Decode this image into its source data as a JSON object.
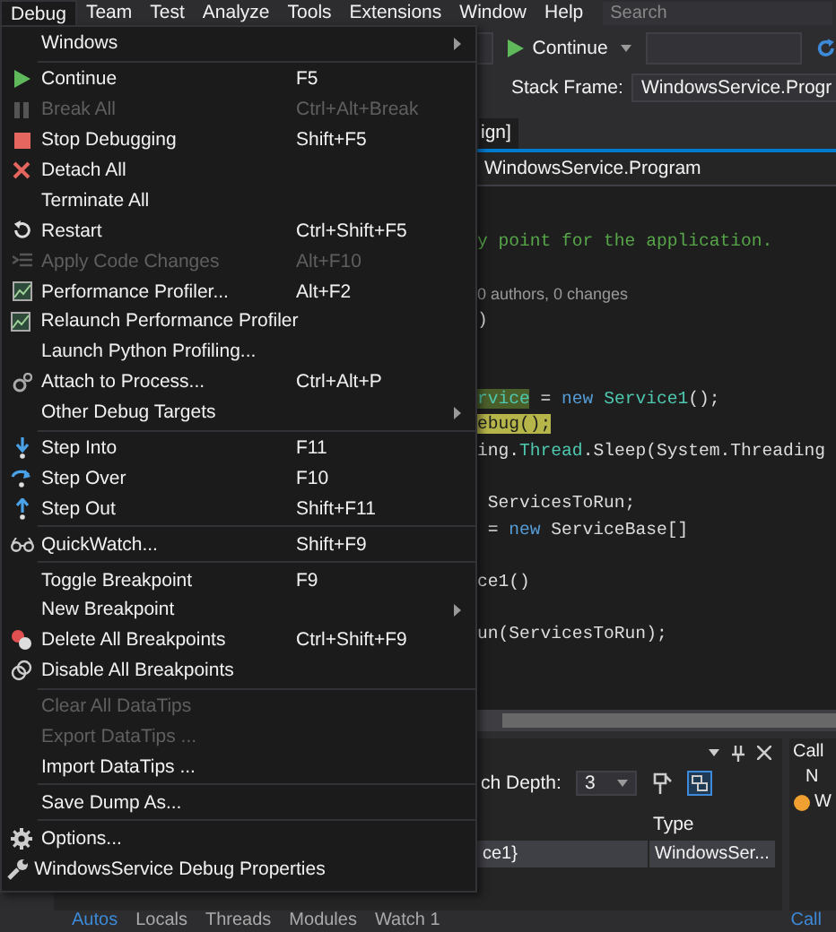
{
  "menubar": {
    "items": [
      {
        "label": "Debug",
        "selected": true
      },
      {
        "label": "Team",
        "selected": false
      },
      {
        "label": "Test",
        "selected": false
      },
      {
        "label": "Analyze",
        "selected": false
      },
      {
        "label": "Tools",
        "selected": false
      },
      {
        "label": "Extensions",
        "selected": false
      },
      {
        "label": "Window",
        "selected": false
      },
      {
        "label": "Help",
        "selected": false
      }
    ],
    "search": {
      "placeholder": "Search"
    }
  },
  "toolbar": {
    "continue_button": "Continue",
    "stack_frame_label": "Stack Frame:",
    "stack_frame_value": "WindowsService.Progr"
  },
  "document_tab": "ign]",
  "navigation_bar": "WindowsService.Program",
  "code_lines": [
    [
      {
        "text": "y point for the application.",
        "kind": "comment"
      }
    ],
    [
      {
        "text": "0 authors, 0 changes",
        "kind": "lens"
      }
    ],
    [
      {
        "text": ")",
        "kind": "plain"
      }
    ],
    [
      {
        "text": "rvice",
        "kind": "hl-green"
      },
      {
        "text": " = ",
        "kind": "plain"
      },
      {
        "text": "new",
        "kind": "keyword"
      },
      {
        "text": " Service1",
        "kind": "type"
      },
      {
        "text": "();",
        "kind": "plain"
      }
    ],
    [
      {
        "text": "ebug();",
        "kind": "hl-yellow"
      }
    ],
    [
      {
        "text": "ing.",
        "kind": "plain"
      },
      {
        "text": "Thread",
        "kind": "type"
      },
      {
        "text": ".Sleep(System.Threading",
        "kind": "plain"
      }
    ],
    [
      {
        "text": " ServicesToRun;",
        "kind": "plain"
      }
    ],
    [
      {
        "text": " = ",
        "kind": "plain"
      },
      {
        "text": "new",
        "kind": "keyword"
      },
      {
        "text": " ServiceBase[]",
        "kind": "plain"
      }
    ],
    [
      {
        "text": "ce1()",
        "kind": "plain"
      }
    ],
    [
      {
        "text": "un(ServicesToRun);",
        "kind": "plain"
      }
    ]
  ],
  "autos_panel": {
    "depth_label": "ch Depth:",
    "depth_value": "3",
    "columns": [
      "Type"
    ],
    "rows": [
      {
        "value": "ce1}",
        "type": "WindowsSer..."
      }
    ]
  },
  "call_stack_panel": {
    "title": "Call",
    "column": "N",
    "row": "W"
  },
  "bottom_tabs": [
    {
      "label": "Autos",
      "selected": true
    },
    {
      "label": "Locals",
      "selected": false
    },
    {
      "label": "Threads",
      "selected": false
    },
    {
      "label": "Modules",
      "selected": false
    },
    {
      "label": "Watch 1",
      "selected": false
    }
  ],
  "bottom_right_tab": "Call",
  "debug_menu": [
    {
      "kind": "item",
      "label": "Windows",
      "submenu": true,
      "disabled": false
    },
    {
      "kind": "separator"
    },
    {
      "kind": "item",
      "label": "Continue",
      "shortcut": "F5",
      "disabled": false
    },
    {
      "kind": "item",
      "label": "Break All",
      "shortcut": "Ctrl+Alt+Break",
      "disabled": true
    },
    {
      "kind": "item",
      "label": "Stop Debugging",
      "shortcut": "Shift+F5",
      "disabled": false
    },
    {
      "kind": "item",
      "label": "Detach All",
      "disabled": false
    },
    {
      "kind": "item",
      "label": "Terminate All",
      "disabled": false
    },
    {
      "kind": "item",
      "label": "Restart",
      "shortcut": "Ctrl+Shift+F5",
      "disabled": false
    },
    {
      "kind": "item",
      "label": "Apply Code Changes",
      "shortcut": "Alt+F10",
      "disabled": true
    },
    {
      "kind": "item",
      "label": "Performance Profiler...",
      "shortcut": "Alt+F2",
      "disabled": false
    },
    {
      "kind": "item",
      "label": "Relaunch Performance Profiler",
      "disabled": false
    },
    {
      "kind": "item",
      "label": "Launch Python Profiling...",
      "disabled": false
    },
    {
      "kind": "item",
      "label": "Attach to Process...",
      "shortcut": "Ctrl+Alt+P",
      "disabled": false
    },
    {
      "kind": "item",
      "label": "Other Debug Targets",
      "submenu": true,
      "disabled": false
    },
    {
      "kind": "separator"
    },
    {
      "kind": "item",
      "label": "Step Into",
      "shortcut": "F11",
      "disabled": false
    },
    {
      "kind": "item",
      "label": "Step Over",
      "shortcut": "F10",
      "disabled": false
    },
    {
      "kind": "item",
      "label": "Step Out",
      "shortcut": "Shift+F11",
      "disabled": false
    },
    {
      "kind": "separator"
    },
    {
      "kind": "item",
      "label": "QuickWatch...",
      "shortcut": "Shift+F9",
      "disabled": false
    },
    {
      "kind": "separator"
    },
    {
      "kind": "item",
      "label": "Toggle Breakpoint",
      "shortcut": "F9",
      "disabled": false
    },
    {
      "kind": "item",
      "label": "New Breakpoint",
      "submenu": true,
      "disabled": false
    },
    {
      "kind": "item",
      "label": "Delete All Breakpoints",
      "shortcut": "Ctrl+Shift+F9",
      "disabled": false
    },
    {
      "kind": "item",
      "label": "Disable All Breakpoints",
      "disabled": false
    },
    {
      "kind": "separator"
    },
    {
      "kind": "item",
      "label": "Clear All DataTips",
      "disabled": true
    },
    {
      "kind": "item",
      "label": "Export DataTips ...",
      "disabled": true
    },
    {
      "kind": "item",
      "label": "Import DataTips ...",
      "disabled": false
    },
    {
      "kind": "separator"
    },
    {
      "kind": "item",
      "label": "Save Dump As...",
      "disabled": false
    },
    {
      "kind": "separator"
    },
    {
      "kind": "item",
      "label": "Options...",
      "disabled": false
    },
    {
      "kind": "item",
      "label": "WindowsService Debug Properties",
      "disabled": false
    }
  ]
}
